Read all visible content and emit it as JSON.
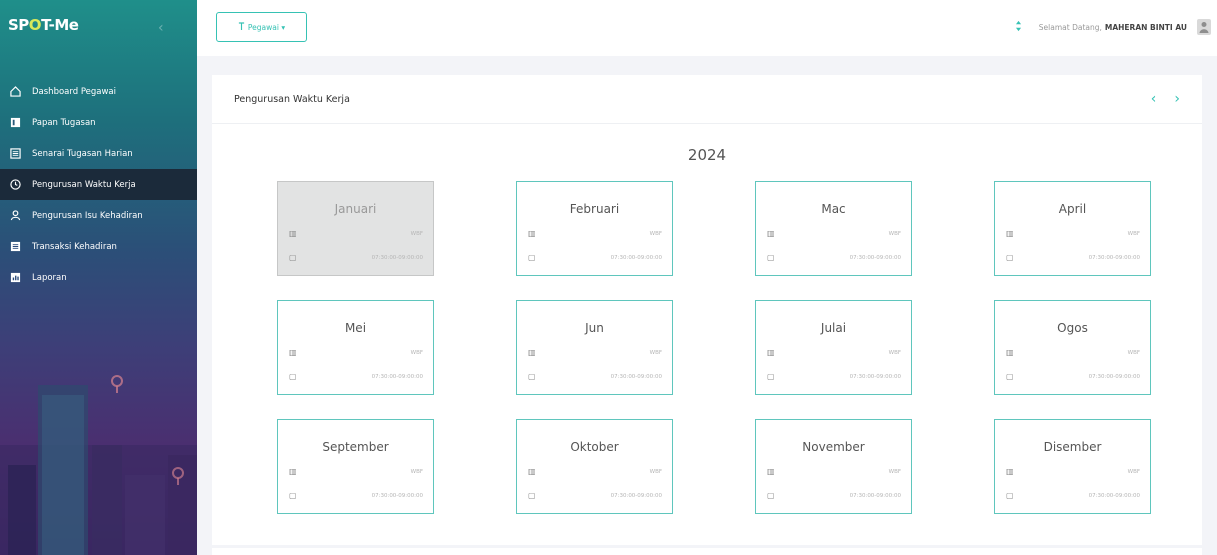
{
  "brand": {
    "text": "SP",
    "dot": "O",
    "suffix": "T-Me"
  },
  "sidebar": {
    "items": [
      {
        "label": "Dashboard Pegawai",
        "icon": "home-icon",
        "active": false
      },
      {
        "label": "Papan Tugasan",
        "icon": "board-icon",
        "active": false
      },
      {
        "label": "Senarai Tugasan Harian",
        "icon": "clipboard-icon",
        "active": false
      },
      {
        "label": "Pengurusan Waktu Kerja",
        "icon": "clock-icon",
        "active": true
      },
      {
        "label": "Pengurusan Isu Kehadiran",
        "icon": "person-icon",
        "active": false
      },
      {
        "label": "Transaksi Kehadiran",
        "icon": "list-icon",
        "active": false
      },
      {
        "label": "Laporan",
        "icon": "report-icon",
        "active": false
      }
    ]
  },
  "topbar": {
    "role_label": "Pegawai ▾",
    "welcome": "Selamat Datang,",
    "user_name": "MAHERAN BINTI AU"
  },
  "card": {
    "title": "Pengurusan Waktu Kerja",
    "prev": "‹",
    "next": "›"
  },
  "year": "2024",
  "months": [
    {
      "name": "Januari",
      "zone": "WBF",
      "hours": "07:30:00-09:00:00",
      "disabled": true
    },
    {
      "name": "Februari",
      "zone": "WBF",
      "hours": "07:30:00-09:00:00",
      "disabled": false
    },
    {
      "name": "Mac",
      "zone": "WBF",
      "hours": "07:30:00-09:00:00",
      "disabled": false
    },
    {
      "name": "April",
      "zone": "WBF",
      "hours": "07:30:00-09:00:00",
      "disabled": false
    },
    {
      "name": "Mei",
      "zone": "WBF",
      "hours": "07:30:00-09:00:00",
      "disabled": false
    },
    {
      "name": "Jun",
      "zone": "WBF",
      "hours": "07:30:00-09:00:00",
      "disabled": false
    },
    {
      "name": "Julai",
      "zone": "WBF",
      "hours": "07:30:00-09:00:00",
      "disabled": false
    },
    {
      "name": "Ogos",
      "zone": "WBF",
      "hours": "07:30:00-09:00:00",
      "disabled": false
    },
    {
      "name": "September",
      "zone": "WBF",
      "hours": "07:30:00-09:00:00",
      "disabled": false
    },
    {
      "name": "Oktober",
      "zone": "WBF",
      "hours": "07:30:00-09:00:00",
      "disabled": false
    },
    {
      "name": "November",
      "zone": "WBF",
      "hours": "07:30:00-09:00:00",
      "disabled": false
    },
    {
      "name": "Disember",
      "zone": "WBF",
      "hours": "07:30:00-09:00:00",
      "disabled": false
    }
  ],
  "colors": {
    "accent": "#36c2b4",
    "active_nav": "#1b2a3a",
    "disabled_card": "#e2e3e3"
  }
}
